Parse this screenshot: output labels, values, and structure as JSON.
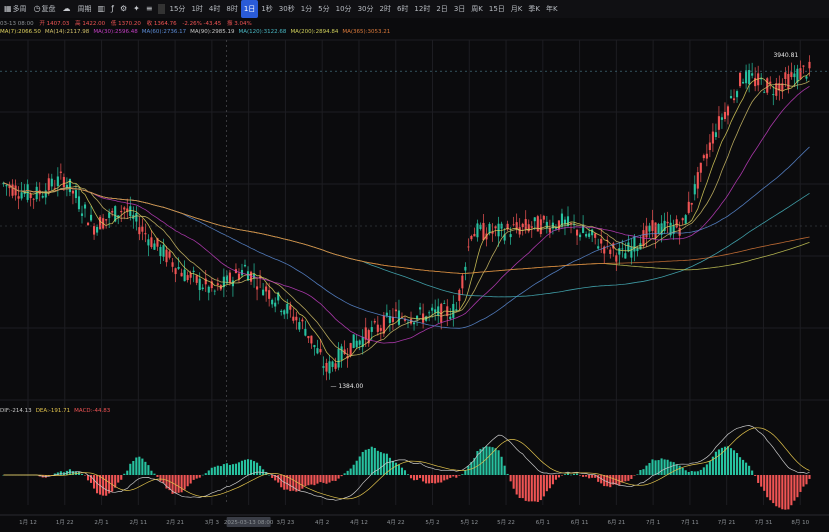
{
  "toolbar": {
    "items": [
      {
        "label": "多周",
        "icon": "layout-icon"
      },
      {
        "label": "复盘",
        "icon": "replay-icon"
      },
      {
        "label": "",
        "icon": "cloud-icon"
      },
      {
        "label": "周期",
        "icon": "period-icon"
      },
      {
        "label": "15分"
      },
      {
        "label": "1时"
      },
      {
        "label": "4时"
      },
      {
        "label": "8时"
      },
      {
        "label": "1日",
        "active": true
      },
      {
        "label": "1秒"
      },
      {
        "label": "30秒"
      },
      {
        "label": "1分"
      },
      {
        "label": "5分"
      },
      {
        "label": "10分"
      },
      {
        "label": "30分"
      },
      {
        "label": "2时"
      },
      {
        "label": "6时"
      },
      {
        "label": "12时"
      },
      {
        "label": "2日"
      },
      {
        "label": "3日"
      },
      {
        "label": "周K"
      },
      {
        "label": "15日"
      },
      {
        "label": "月K"
      },
      {
        "label": "季K"
      },
      {
        "label": "年K"
      }
    ],
    "tools": [
      "bar-chart-icon",
      "fx-icon",
      "gear-icon",
      "star-icon",
      "settings-icon"
    ]
  },
  "info_bar": {
    "date": "03-13 08:00",
    "open": "开 1407.03",
    "high": "高 1422.00",
    "low": "低 1370.20",
    "close": "收 1364.76",
    "change": "-2.26% -43.45",
    "amp": "振 3.04%"
  },
  "ma_labels": [
    {
      "text": "MA(7):2066.50",
      "color": "#e0d35e"
    },
    {
      "text": "MA(14):2117.98",
      "color": "#d1c06a"
    },
    {
      "text": "MA(30):2596.48",
      "color": "#c23ec1"
    },
    {
      "text": "MA(60):2736.17",
      "color": "#5c8cd6"
    },
    {
      "text": "MA(90):2985.19",
      "color": "#c7c7c7"
    },
    {
      "text": "MA(120):3122.68",
      "color": "#49b7c2"
    },
    {
      "text": "MA(200):2894.84",
      "color": "#cfcf5a"
    },
    {
      "text": "MA(365):3053.21",
      "color": "#d9793a"
    }
  ],
  "macd_labels": [
    {
      "text": "DIF:-214.13",
      "color": "#c9c9c9"
    },
    {
      "text": "DEA:-191.71",
      "color": "#e0c24c"
    },
    {
      "text": "MACD:-44.83",
      "color": "#f05454"
    }
  ],
  "colors": {
    "up": "#27c2a0",
    "down": "#f05454",
    "bg": "#0b0b0d",
    "grid": "#1d1d22"
  },
  "chart_data": {
    "type": "candlestick",
    "x_ticks": [
      "1月 12",
      "1月 22",
      "2月 1",
      "2月 11",
      "2月 21",
      "3月 3",
      "2025-03-13 08:00",
      "3月 23",
      "4月 2",
      "4月 12",
      "4月 22",
      "5月 2",
      "5月 12",
      "5月 22",
      "6月 1",
      "6月 11",
      "6月 21",
      "7月 1",
      "7月 11",
      "7月 21",
      "7月 31",
      "8月 10"
    ],
    "price_labels": {
      "high_marker": "3940.81",
      "low_marker": "1384.00",
      "current": ""
    },
    "ylim": [
      1200,
      4200
    ],
    "annotations": [
      "3940.81",
      "1384.00"
    ]
  }
}
